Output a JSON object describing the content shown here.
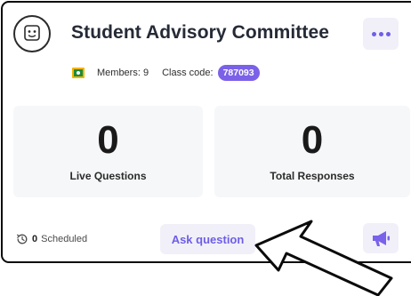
{
  "header": {
    "title": "Student Advisory Committee",
    "more_icon": "more-horizontal-icon",
    "avatar_icon": "robot-face-icon"
  },
  "meta": {
    "classroom_icon": "google-classroom-icon",
    "members_text": "Members: 9",
    "class_code_label": "Class code:",
    "class_code": "787093"
  },
  "stats": {
    "live": {
      "value": "0",
      "label": "Live Questions"
    },
    "total": {
      "value": "0",
      "label": "Total Responses"
    }
  },
  "footer": {
    "scheduled_icon": "history-clock-icon",
    "scheduled_count": "0",
    "scheduled_label": "Scheduled",
    "ask_button_label": "Ask question",
    "announce_icon": "megaphone-icon"
  },
  "annotation": {
    "arrow_icon": "pointer-arrow-annotation"
  },
  "colors": {
    "accent": "#6e5ee6",
    "badge": "#7b61e8",
    "button_bg": "#f1f0f9",
    "stat_bg": "#f6f7f9"
  }
}
